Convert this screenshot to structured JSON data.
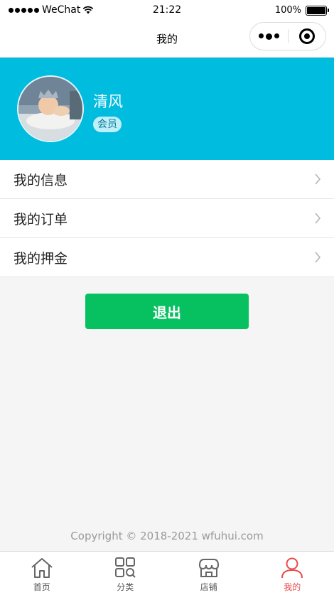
{
  "status_bar": {
    "carrier": "WeChat",
    "time": "21:22",
    "battery": "100%",
    "battery_level": 1.0
  },
  "nav": {
    "title": "我的"
  },
  "profile": {
    "username": "清风",
    "badge": "会员"
  },
  "menu": {
    "items": [
      {
        "label": "我的信息"
      },
      {
        "label": "我的订单"
      },
      {
        "label": "我的押金"
      }
    ]
  },
  "logout_label": "退出",
  "footer": {
    "copyright": "Copyright © 2018-2021 wfuhui.com"
  },
  "tabbar": {
    "items": [
      {
        "label": "首页",
        "icon": "home-icon"
      },
      {
        "label": "分类",
        "icon": "category-icon"
      },
      {
        "label": "店铺",
        "icon": "store-icon"
      },
      {
        "label": "我的",
        "icon": "user-icon",
        "active": true
      }
    ]
  },
  "colors": {
    "header_bg": "#00bde0",
    "logout_bg": "#07c160",
    "active_tab": "#e94b4b"
  }
}
